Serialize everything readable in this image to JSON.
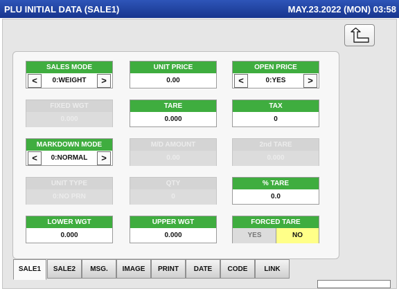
{
  "header": {
    "title": "PLU INITIAL DATA (SALE1)",
    "datetime": "MAY.23.2022 (MON) 03:58"
  },
  "colors": {
    "title_bar": "#1f3fa0",
    "field_header": "#3fad3f",
    "selected_toggle": "#ffff88"
  },
  "back_button": {
    "icon": "return-arrow-icon"
  },
  "fields": {
    "sales_mode": {
      "label": "SALES MODE",
      "value": "0:WEIGHT"
    },
    "unit_price": {
      "label": "UNIT PRICE",
      "value": "0.00"
    },
    "open_price": {
      "label": "OPEN PRICE",
      "value": "0:YES"
    },
    "fixed_wgt": {
      "label": "FIXED WGT",
      "value": "0.000"
    },
    "tare": {
      "label": "TARE",
      "value": "0.000"
    },
    "tax": {
      "label": "TAX",
      "value": "0"
    },
    "markdown_mode": {
      "label": "MARKDOWN MODE",
      "value": "0:NORMAL"
    },
    "md_amount": {
      "label": "M/D AMOUNT",
      "value": "0.00"
    },
    "second_tare": {
      "label": "2nd TARE",
      "value": "0.000"
    },
    "unit_type": {
      "label": "UNIT TYPE",
      "value": "0:NO PRN"
    },
    "qty": {
      "label": "QTY",
      "value": "0"
    },
    "pct_tare": {
      "label": "% TARE",
      "value": "0.0"
    },
    "lower_wgt": {
      "label": "LOWER WGT",
      "value": "0.000"
    },
    "upper_wgt": {
      "label": "UPPER WGT",
      "value": "0.000"
    },
    "forced_tare": {
      "label": "FORCED TARE",
      "yes": "YES",
      "no": "NO",
      "selected": "NO"
    }
  },
  "arrows": {
    "left": "<",
    "right": ">"
  },
  "tabs": [
    {
      "label": "SALE1",
      "active": true
    },
    {
      "label": "SALE2"
    },
    {
      "label": "MSG."
    },
    {
      "label": "IMAGE"
    },
    {
      "label": "PRINT"
    },
    {
      "label": "DATE"
    },
    {
      "label": "CODE"
    },
    {
      "label": "LINK"
    }
  ]
}
